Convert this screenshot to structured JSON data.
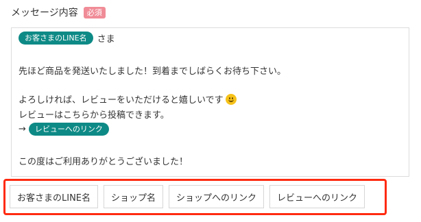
{
  "form": {
    "field_label": "メッセージ内容",
    "required_badge": "必須"
  },
  "message": {
    "line1_chip": "お客さまのLINE名",
    "line1_suffix": "さま",
    "line2": "先ほど商品を発送いたしました！到着までしばらくお待ち下さい。",
    "line3": "よろしければ、レビューをいただけると嬉しいです",
    "line3_emoji": "smiling-face-emoji",
    "line4": "レビューはこちらから投稿できます。",
    "line5_arrow": "→",
    "line5_chip": "レビューへのリンク",
    "line6": "この度はご利用ありがとうございました！"
  },
  "insert_buttons": [
    {
      "label": "お客さまのLINE名"
    },
    {
      "label": "ショップ名"
    },
    {
      "label": "ショップへのリンク"
    },
    {
      "label": "レビューへのリンク"
    }
  ],
  "colors": {
    "chip": "#0e8a86",
    "required_badge": "#f08c97",
    "highlight": "#ff2a10"
  }
}
